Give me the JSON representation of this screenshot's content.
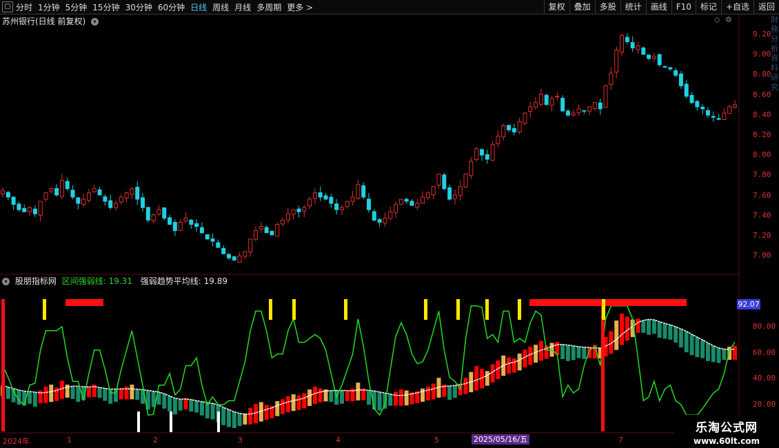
{
  "toolbar": {
    "menu_icon": "square-menu-icon",
    "periods": [
      "分时",
      "1分钟",
      "5分钟",
      "15分钟",
      "30分钟",
      "60分钟",
      "日线",
      "周线",
      "月线",
      "多周期",
      "更多 >"
    ],
    "active_period": "日线",
    "right_buttons": [
      "复权",
      "叠加",
      "多股",
      "统计",
      "画线",
      "F10",
      "标记",
      "+自选",
      "返回"
    ]
  },
  "main_panel": {
    "title": "苏州银行(日线 前复权)",
    "y_ticks": [
      "9.20",
      "9.00",
      "8.80",
      "8.60",
      "8.40",
      "8.20",
      "8.00",
      "7.80",
      "7.60",
      "7.40",
      "7.20",
      "7.00"
    ]
  },
  "indicator_panel": {
    "name": "股朋指标网",
    "line1_label": "区间强弱线:",
    "line1_value": "19.31",
    "line2_label": "强弱趋势平均线:",
    "line2_value": "19.89",
    "y_ticks": [
      "80.00",
      "60.00",
      "40.00",
      "20.00"
    ],
    "current_tag": "92.07"
  },
  "x_axis": {
    "labels": [
      "2024年",
      "1",
      "2",
      "3",
      "4",
      "5",
      "7"
    ],
    "cursor_date": "2025/05/16/五"
  },
  "watermark": {
    "title": "乐淘公式网",
    "url": "www.60lt.com"
  },
  "colors": {
    "up": "#e03030",
    "down": "#1fd0e0",
    "strong": "#22dd22",
    "avg": "#ffffff",
    "bar_up": "#ff0000",
    "bar_fill": "#e8b050",
    "bar_down": "#1a8a6a"
  },
  "chart_data": {
    "type": "candlestick",
    "title": "苏州银行(日线 前复权)",
    "ylim": [
      6.95,
      9.3
    ],
    "close": [
      7.68,
      7.62,
      7.55,
      7.5,
      7.48,
      7.52,
      7.46,
      7.58,
      7.66,
      7.7,
      7.64,
      7.78,
      7.7,
      7.62,
      7.56,
      7.6,
      7.66,
      7.7,
      7.64,
      7.58,
      7.52,
      7.56,
      7.62,
      7.66,
      7.7,
      7.6,
      7.52,
      7.4,
      7.45,
      7.5,
      7.42,
      7.36,
      7.3,
      7.38,
      7.42,
      7.36,
      7.34,
      7.28,
      7.22,
      7.2,
      7.14,
      7.08,
      7.04,
      7.02,
      7.06,
      7.1,
      7.22,
      7.3,
      7.34,
      7.28,
      7.26,
      7.36,
      7.4,
      7.46,
      7.5,
      7.48,
      7.52,
      7.6,
      7.66,
      7.62,
      7.6,
      7.56,
      7.5,
      7.52,
      7.58,
      7.62,
      7.74,
      7.62,
      7.5,
      7.4,
      7.38,
      7.42,
      7.48,
      7.55,
      7.6,
      7.58,
      7.54,
      7.56,
      7.62,
      7.66,
      7.72,
      7.84,
      7.7,
      7.6,
      7.64,
      7.72,
      7.84,
      7.96,
      8.08,
      8.02,
      7.98,
      8.12,
      8.2,
      8.3,
      8.26,
      8.24,
      8.34,
      8.42,
      8.48,
      8.52,
      8.6,
      8.5,
      8.56,
      8.58,
      8.44,
      8.4,
      8.42,
      8.46,
      8.44,
      8.48,
      8.52,
      8.46,
      8.68,
      8.8,
      9.02,
      9.16,
      9.1,
      9.04,
      9.06,
      8.98,
      8.94,
      8.96,
      8.88,
      8.86,
      8.84,
      8.78,
      8.68,
      8.58,
      8.52,
      8.48,
      8.46,
      8.4,
      8.38,
      8.36,
      8.42,
      8.48,
      8.5
    ]
  }
}
